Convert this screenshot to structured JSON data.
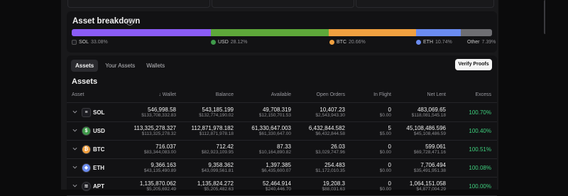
{
  "breakdown": {
    "title": "Asset breakdown",
    "segments": [
      {
        "name": "SOL",
        "pct": "33.08%",
        "share": 33.08,
        "color": "#8b5cf6"
      },
      {
        "name": "USD",
        "pct": "28.12%",
        "share": 28.12,
        "color": "#5ea83a"
      },
      {
        "name": "BTC",
        "pct": "20.66%",
        "share": 20.66,
        "color": "#f0a040"
      },
      {
        "name": "ETH",
        "pct": "10.74%",
        "share": 10.74,
        "color": "#6b8cf0"
      },
      {
        "name": "Other",
        "pct": "7.39%",
        "share": 7.39,
        "color": "#6e6e72"
      }
    ]
  },
  "tabs": [
    {
      "label": "Assets",
      "active": true
    },
    {
      "label": "Your Assets",
      "active": false
    },
    {
      "label": "Wallets",
      "active": false
    }
  ],
  "verify_label": "Verify Proofs",
  "assets_title": "Assets",
  "columns": {
    "asset": "Asset",
    "wallet": "Wallet",
    "balance": "Balance",
    "available": "Available",
    "open_orders": "Open Orders",
    "in_flight": "In Flight",
    "net_lent": "Net Lent",
    "excess": "Excess"
  },
  "rows": [
    {
      "symbol": "SOL",
      "icon": "sol-icon",
      "wallet": "546,998.58",
      "wallet_usd": "$133,708,332.83",
      "balance": "543,185.199",
      "balance_usd": "$132,774,190.02",
      "available": "49,708.319",
      "available_usd": "$12,150,701.53",
      "open_orders": "10,407.23",
      "open_orders_usd": "$2,543,943.30",
      "in_flight": "0",
      "in_flight_usd": "$0.00",
      "net_lent": "483,069.65",
      "net_lent_usd": "$118,081,545.18",
      "excess": "100.70%"
    },
    {
      "symbol": "USD",
      "icon": "usd-icon",
      "wallet": "113,325,278.327",
      "wallet_usd": "$113,325,278.32",
      "balance": "112,871,978.182",
      "balance_usd": "$112,871,978.18",
      "available": "61,330,647.003",
      "available_usd": "$61,330,647.00",
      "open_orders": "6,432,844.582",
      "open_orders_usd": "$6,432,844.58",
      "in_flight": "5",
      "in_flight_usd": "$5.00",
      "net_lent": "45,108,486.596",
      "net_lent_usd": "$45,108,486.59",
      "excess": "100.40%"
    },
    {
      "symbol": "BTC",
      "icon": "btc-icon",
      "wallet": "716.037",
      "wallet_usd": "$83,344,083.00",
      "balance": "712.42",
      "balance_usd": "$82,923,109.95",
      "available": "87.33",
      "available_usd": "$10,164,890.82",
      "open_orders": "26.03",
      "open_orders_usd": "$3,029,747.96",
      "in_flight": "0",
      "in_flight_usd": "$0.00",
      "net_lent": "599.061",
      "net_lent_usd": "$69,728,471.16",
      "excess": "100.51%"
    },
    {
      "symbol": "ETH",
      "icon": "eth-icon",
      "wallet": "9,366.163",
      "wallet_usd": "$43,135,490.89",
      "balance": "9,358.362",
      "balance_usd": "$43,099,561.81",
      "available": "1,397.385",
      "available_usd": "$6,435,600.07",
      "open_orders": "254.483",
      "open_orders_usd": "$1,172,010.35",
      "in_flight": "0",
      "in_flight_usd": "$0.00",
      "net_lent": "7,706.494",
      "net_lent_usd": "$35,491,951.38",
      "excess": "100.08%"
    },
    {
      "symbol": "APT",
      "icon": "apt-icon",
      "wallet": "1,135,870.062",
      "wallet_usd": "$5,205,692.49",
      "balance": "1,135,824.272",
      "balance_usd": "$5,205,482.63",
      "available": "52,464.914",
      "available_usd": "$240,446.70",
      "open_orders": "19,208.3",
      "open_orders_usd": "$88,031.63",
      "in_flight": "0",
      "in_flight_usd": "$0.00",
      "net_lent": "1,064,151.058",
      "net_lent_usd": "$4,877,004.29",
      "excess": "100.00%"
    }
  ]
}
